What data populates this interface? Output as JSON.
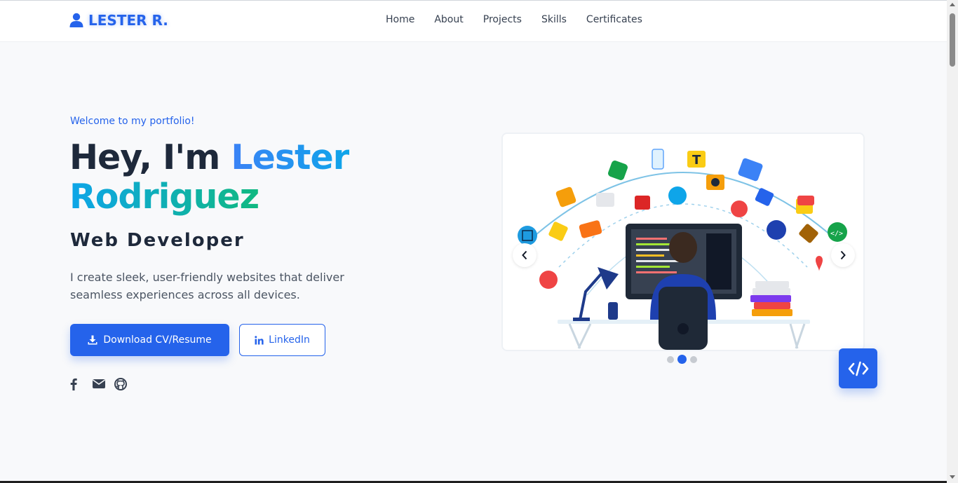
{
  "brand": {
    "name": "LESTER R.",
    "icon": "user-icon",
    "color": "#2563eb"
  },
  "nav": {
    "items": [
      {
        "label": "Home"
      },
      {
        "label": "About"
      },
      {
        "label": "Projects"
      },
      {
        "label": "Skills"
      },
      {
        "label": "Certificates"
      }
    ]
  },
  "hero": {
    "welcome": "Welcome to my portfolio!",
    "greeting": "Hey, I'm",
    "first_name": "Lester",
    "last_name": "Rodriguez",
    "role": "Web Developer",
    "description": "I create sleek, user-friendly websites that deliver seamless experiences across all devices.",
    "cv_button": {
      "label": "Download CV/Resume",
      "icon": "download-icon"
    },
    "linkedin_button": {
      "label": "LinkedIn",
      "icon": "linkedin-icon"
    },
    "socials": [
      {
        "icon": "facebook-icon"
      },
      {
        "icon": "envelope-icon"
      },
      {
        "icon": "github-icon"
      }
    ]
  },
  "carousel": {
    "active_slide": 2,
    "slide_count": 3,
    "prev_icon": "chevron-left-icon",
    "next_icon": "chevron-right-icon"
  },
  "fab": {
    "icon": "code-icon"
  },
  "colors": {
    "accent": "#2563eb",
    "gradient_start": "#3b82f6",
    "gradient_end": "#10b981",
    "heading": "#1e293b"
  }
}
